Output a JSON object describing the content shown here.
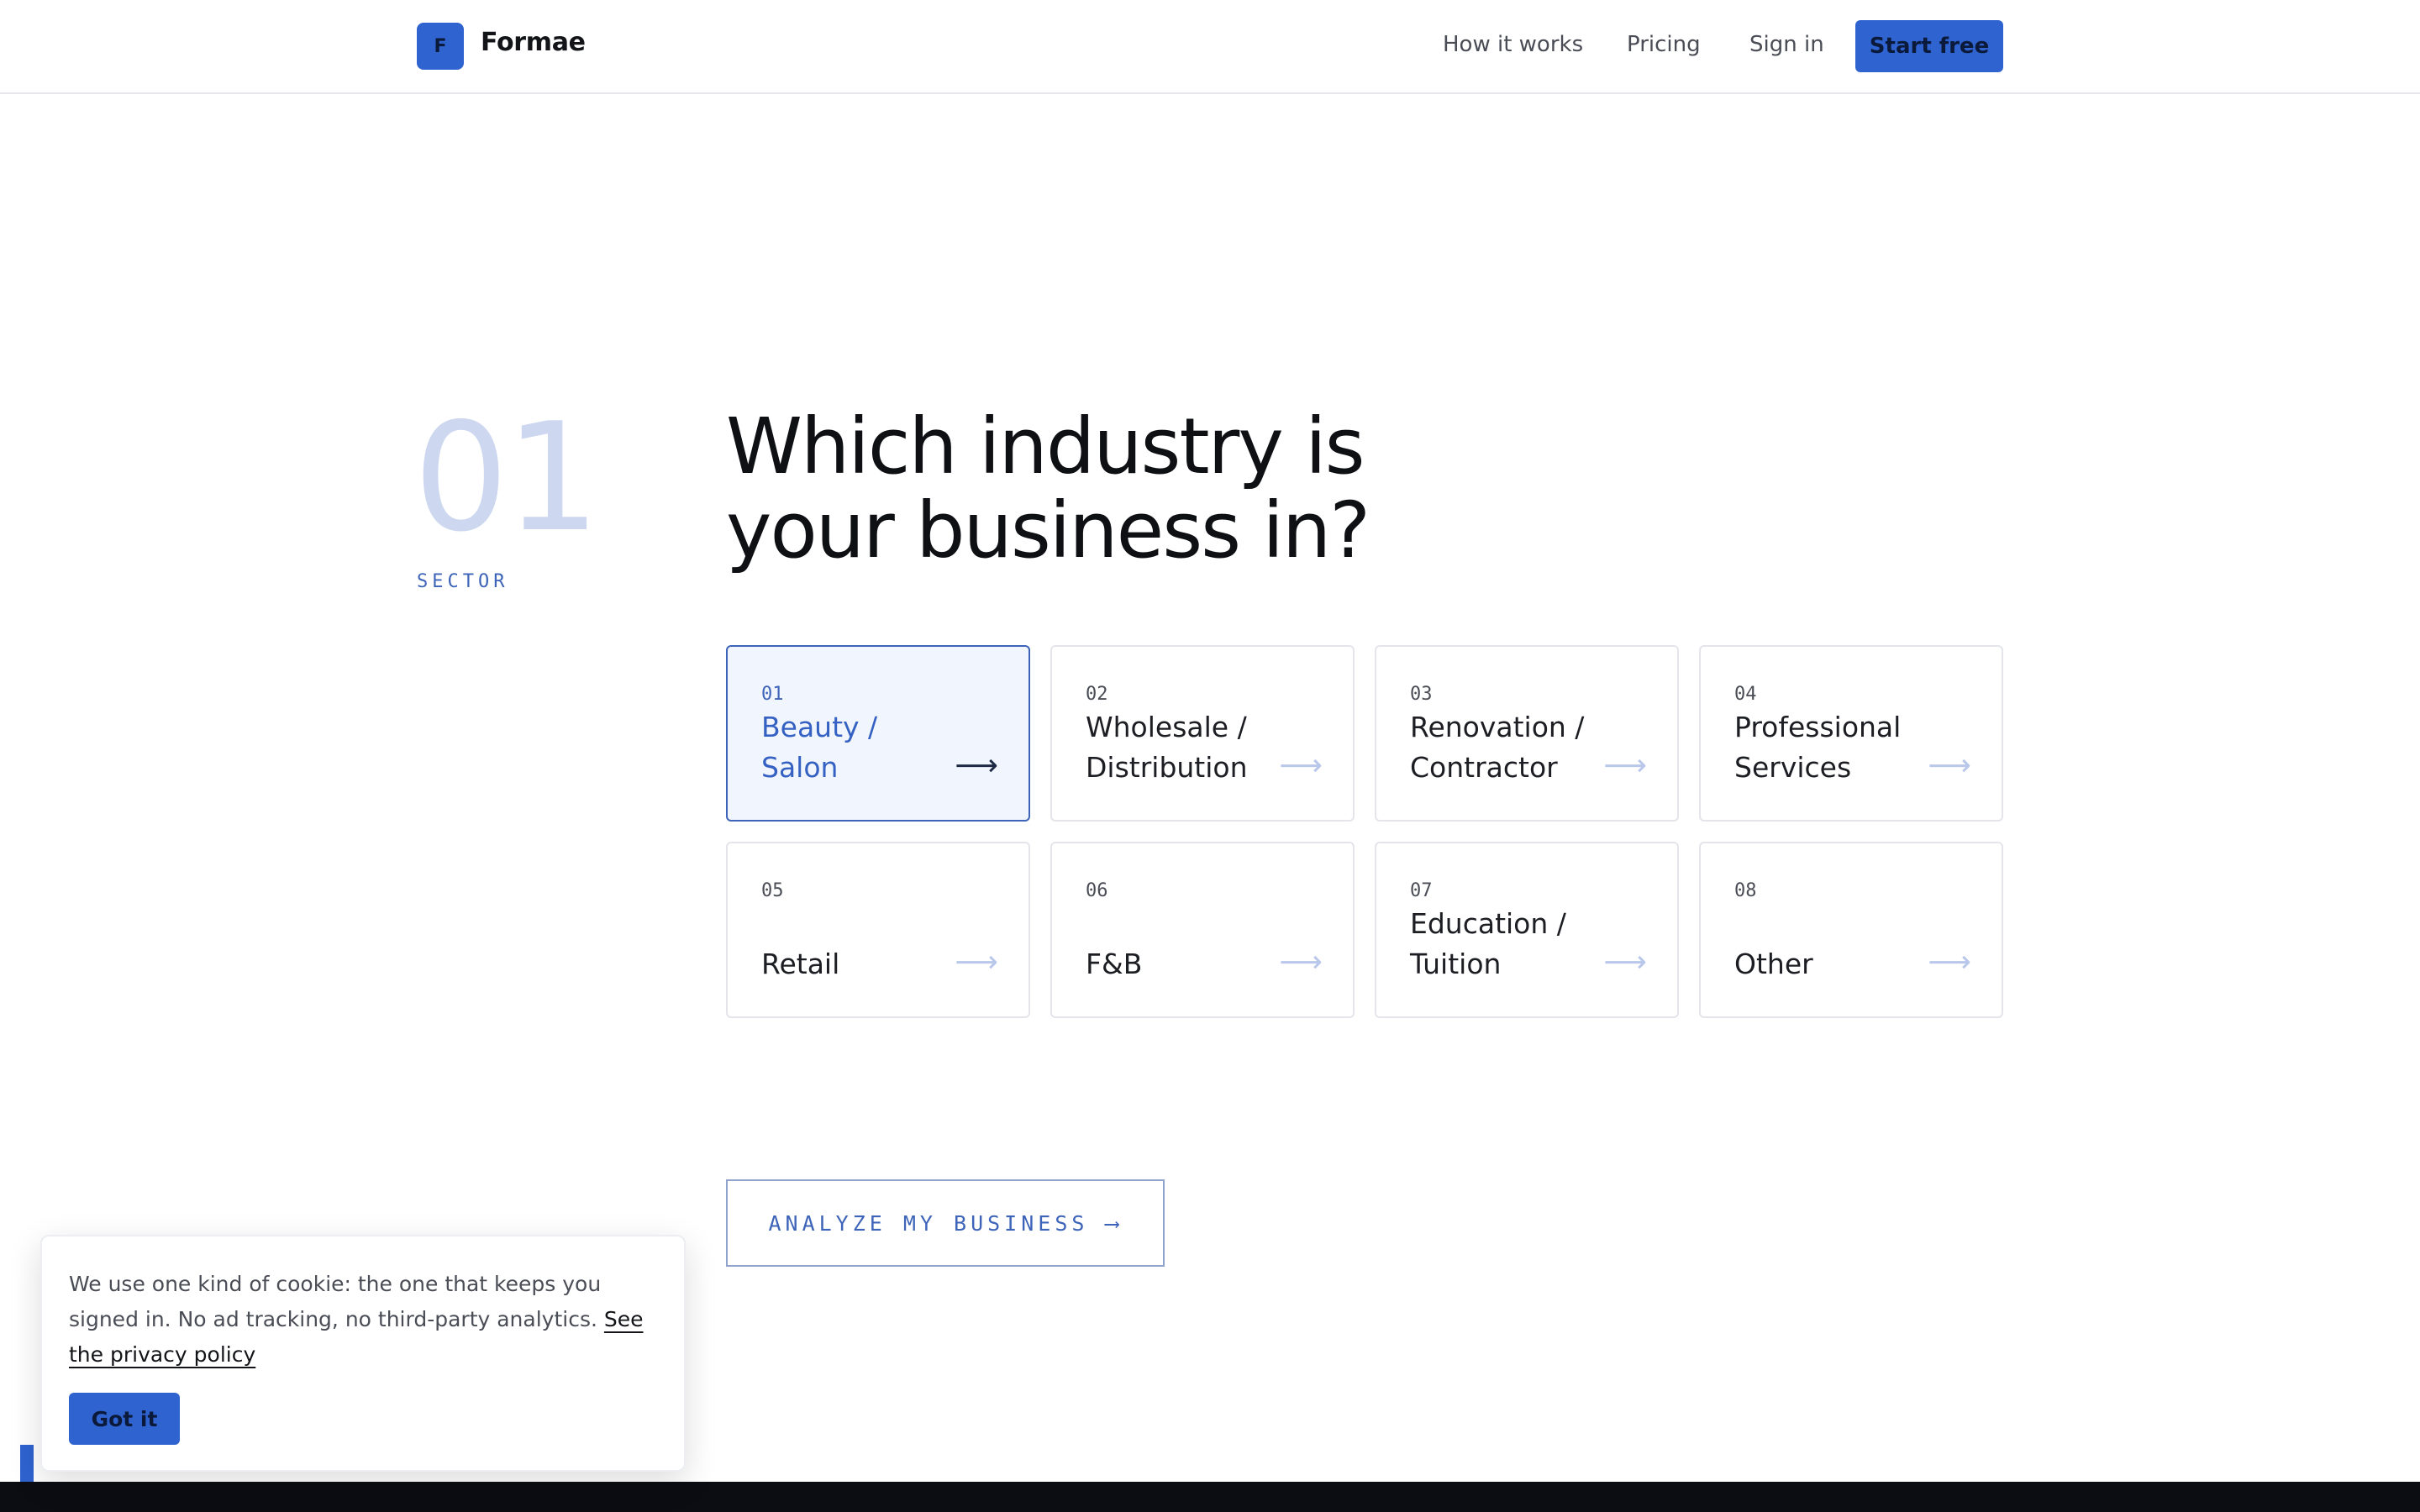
{
  "header": {
    "logo_letter": "F",
    "brand": "Formae",
    "nav": {
      "how_it_works": "How it works",
      "pricing": "Pricing",
      "sign_in": "Sign in"
    },
    "cta": "Start free"
  },
  "step": {
    "number": "01",
    "label": "SECTOR"
  },
  "question": {
    "line1": "Which industry is",
    "line2": "your business in?"
  },
  "options": [
    {
      "num": "01",
      "label": "Beauty / Salon",
      "selected": true
    },
    {
      "num": "02",
      "label": "Wholesale / Distribution",
      "selected": false
    },
    {
      "num": "03",
      "label": "Renovation / Contractor",
      "selected": false
    },
    {
      "num": "04",
      "label": "Professional Services",
      "selected": false
    },
    {
      "num": "05",
      "label": "Retail",
      "selected": false
    },
    {
      "num": "06",
      "label": "F&B",
      "selected": false
    },
    {
      "num": "07",
      "label": "Education / Tuition",
      "selected": false
    },
    {
      "num": "08",
      "label": "Other",
      "selected": false
    }
  ],
  "arrow_glyph": "⟶",
  "analyze": {
    "label": "ANALYZE MY BUSINESS",
    "arrow": "⟶"
  },
  "cookie": {
    "text": "We use one kind of cookie: the one that keeps you signed in. No ad tracking, no third-party analytics. ",
    "link": "See the privacy policy",
    "button": "Got it"
  },
  "colors": {
    "accent": "#2f63cf",
    "selected_border": "#3d64b8",
    "selected_bg": "#f1f5fd",
    "footer": "#0c0d12"
  }
}
